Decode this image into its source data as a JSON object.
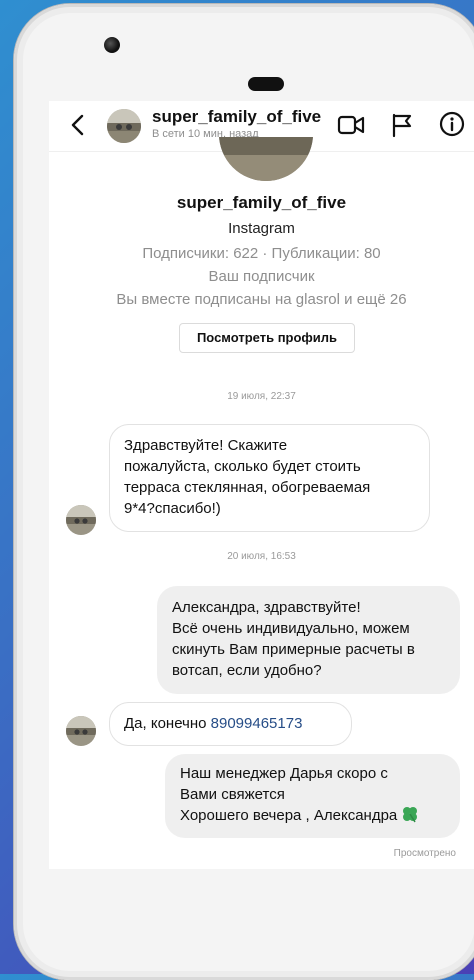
{
  "header": {
    "username": "super_family_of_five",
    "status": "В сети 10 мин. назад",
    "icons": [
      "back-icon",
      "video-call-icon",
      "flag-icon",
      "info-icon"
    ]
  },
  "profile": {
    "name": "super_family_of_five",
    "platform": "Instagram",
    "stats": "Подписчики: 622 · Публикации: 80",
    "follower_note": "Ваш подписчик",
    "mutual": "Вы вместе подписаны на glasrol и ещё 26",
    "view_profile_label": "Посмотреть профиль"
  },
  "messages": [
    {
      "type": "timestamp",
      "text": "19 июля, 22:37"
    },
    {
      "type": "incoming",
      "lines": [
        "Здравствуйте! Скажите",
        "пожалуйста, сколько будет стоить",
        "терраса стеклянная, обогреваемая",
        "9*4?спасибо!)"
      ]
    },
    {
      "type": "timestamp",
      "text": "20 июля, 16:53"
    },
    {
      "type": "outgoing",
      "lines": [
        "Александра, здравствуйте!",
        "Всё очень индивидуально, можем",
        "скинуть Вам примерные расчеты в",
        "вотсап, если удобно?"
      ]
    },
    {
      "type": "incoming",
      "text": "Да, конечно ",
      "phone": "89099465173"
    },
    {
      "type": "outgoing",
      "lines": [
        "Наш менеджер Дарья скоро с",
        "Вами свяжется",
        "Хорошего вечера , Александра"
      ],
      "emoji": "four-leaf-clover-icon"
    }
  ],
  "seen_label": "Просмотрено",
  "colors": {
    "link": "#264d87",
    "outgoing_bubble": "#efefef",
    "muted_text": "#8e8e8e"
  }
}
